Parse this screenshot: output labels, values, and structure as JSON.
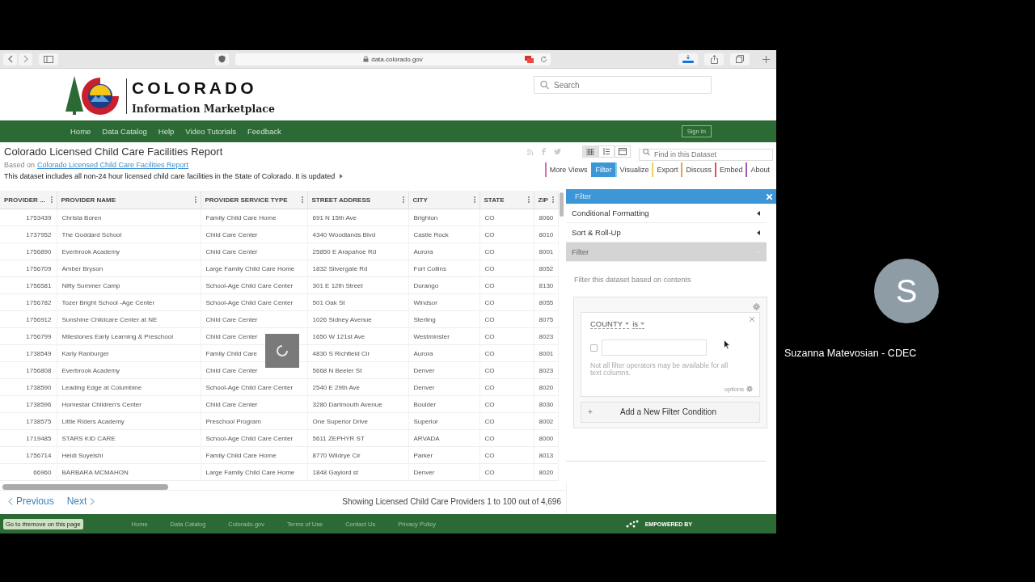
{
  "browser": {
    "url": "data.colorado.gov"
  },
  "site_header": {
    "logo_title": "COLORADO",
    "logo_subtitle": "Information Marketplace",
    "search": {
      "placeholder": "Search"
    }
  },
  "nav": {
    "items": [
      "Home",
      "Data Catalog",
      "Help",
      "Video Tutorials",
      "Feedback"
    ],
    "sign_in": "Sign In"
  },
  "dataset": {
    "title": "Colorado Licensed Child Care Facilities Report",
    "based_on_label": "Based on",
    "based_on_link": "Colorado Licensed Child Care Facilities Report",
    "description": "This dataset includes all non-24 hour licensed child care facilities in the State of Colorado. It is updated",
    "find_placeholder": "Find in this Dataset",
    "view_modes": [
      {
        "kind": "grid",
        "selected": true
      },
      {
        "kind": "list",
        "selected": false
      },
      {
        "kind": "card",
        "selected": false
      }
    ],
    "actions": [
      {
        "label": "More Views",
        "color": "#d46cc0",
        "selected": false
      },
      {
        "label": "Filter",
        "color": "#3d97d6",
        "selected": true
      },
      {
        "label": "Visualize",
        "color": "#8fd0ea",
        "selected": false
      },
      {
        "label": "Export",
        "color": "#f2cf63",
        "selected": false
      },
      {
        "label": "Discuss",
        "color": "#f0a04b",
        "selected": false
      },
      {
        "label": "Embed",
        "color": "#d9534f",
        "selected": false
      },
      {
        "label": "About",
        "color": "#9b59b6",
        "selected": false
      }
    ]
  },
  "table": {
    "columns": [
      "PROVIDER ...",
      "PROVIDER NAME",
      "PROVIDER SERVICE TYPE",
      "STREET ADDRESS",
      "CITY",
      "STATE",
      "ZIP"
    ],
    "rows": [
      [
        "1753439",
        "Christa Boren",
        "Family Child Care Home",
        "691 N 15th Ave",
        "Brighton",
        "CO",
        "8060"
      ],
      [
        "1737952",
        "The Goddard School",
        "Child Care Center",
        "4340 Woodlands Blvd",
        "Castle Rock",
        "CO",
        "8010"
      ],
      [
        "1756890",
        "Everbrook Academy",
        "Child Care Center",
        "25850 E Arapahoe Rd",
        "Aurora",
        "CO",
        "8001"
      ],
      [
        "1756709",
        "Amber Bryson",
        "Large Family Child Care Home",
        "1832 Silvergate Rd",
        "Fort Collins",
        "CO",
        "8052"
      ],
      [
        "1756581",
        "Nifty Summer Camp",
        "School-Age Child Care Center",
        "301 E 12th Street",
        "Durango",
        "CO",
        "8130"
      ],
      [
        "1756782",
        "Tozer Bright School -Age Center",
        "School-Age Child Care Center",
        "501 Oak St",
        "Windsor",
        "CO",
        "8055"
      ],
      [
        "1756912",
        "Sunshine Childcare Center at NE",
        "Child Care Center",
        "1026 Sidney Avenue",
        "Sterling",
        "CO",
        "8075"
      ],
      [
        "1756799",
        "Milestones Early Learning & Preschool",
        "Child Care Center",
        "1650 W 121st Ave",
        "Westminster",
        "CO",
        "8023"
      ],
      [
        "1738549",
        "Karly Ranburger",
        "Family Child Care",
        "4830 S Richfield Cir",
        "Aurora",
        "CO",
        "8001"
      ],
      [
        "1756808",
        "Everbrook Academy",
        "Child Care Center",
        "5668 N Beeler St",
        "Denver",
        "CO",
        "8023"
      ],
      [
        "1738590",
        "Leading Edge at Columbine",
        "School-Age Child Care Center",
        "2540 E 29th Ave",
        "Denver",
        "CO",
        "8020"
      ],
      [
        "1738596",
        "Homestar Children's Center",
        "Child Care Center",
        "3280 Dartmouth Avenue",
        "Boulder",
        "CO",
        "8030"
      ],
      [
        "1738575",
        "Little Riders Academy",
        "Preschool Program",
        "One Superior Drive",
        "Superior",
        "CO",
        "8002"
      ],
      [
        "1719485",
        "STARS KID CARE",
        "School-Age Child Care Center",
        "5611 ZEPHYR ST",
        "ARVADA",
        "CO",
        "8000"
      ],
      [
        "1756714",
        "Heidi Suyeishi",
        "Family Child Care Home",
        "8770 Wildrye Cir",
        "Parker",
        "CO",
        "8013"
      ],
      [
        "66960",
        "BARBARA MCMAHON",
        "Large Family Child Care Home",
        "1848 Gaylord st",
        "Denver",
        "CO",
        "8020"
      ]
    ]
  },
  "filter_panel": {
    "title": "Filter",
    "sections": [
      {
        "label": "Conditional Formatting",
        "expanded": false
      },
      {
        "label": "Sort & Roll-Up",
        "expanded": false
      },
      {
        "label": "Filter",
        "expanded": true
      }
    ],
    "intro": "Filter this dataset based on contents",
    "condition": {
      "column": "COUNTY",
      "operator": "is",
      "checked": false,
      "note": "Not all filter operators may be available for all text columns.",
      "options_label": "options"
    },
    "add_button": {
      "icon": "+",
      "label": "Add a New Filter Condition"
    }
  },
  "pagination": {
    "previous": "Previous",
    "next": "Next",
    "summary": "Showing Licensed Child Care Providers 1 to 100 out of 4,696"
  },
  "status_tooltip": "Go to #remove on this page",
  "footer": {
    "links": [
      "Home",
      "Data Catalog",
      "Colorado.gov",
      "Terms of Use",
      "Contact Us",
      "Privacy Policy"
    ],
    "powered_by": "EMPOWERED BY"
  },
  "participant": {
    "initial": "S",
    "name": "Suzanna Matevosian - CDEC"
  }
}
